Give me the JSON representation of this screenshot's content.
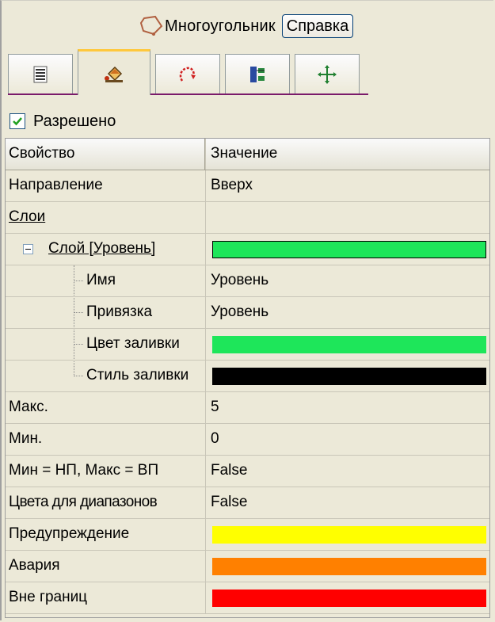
{
  "header": {
    "title": "Многоугольник",
    "help_label": "Справка",
    "icon": "polygon-icon"
  },
  "tabs": [
    {
      "icon": "list-icon",
      "active": false
    },
    {
      "icon": "paint-bucket-icon",
      "active": true
    },
    {
      "icon": "rotate-icon",
      "active": false
    },
    {
      "icon": "align-icon",
      "active": false
    },
    {
      "icon": "move-icon",
      "active": false
    }
  ],
  "enabled": {
    "label": "Разрешено",
    "checked": true
  },
  "grid": {
    "columns": [
      "Свойство",
      "Значение"
    ],
    "rows": {
      "direction": {
        "name": "Направление",
        "value": "Вверх"
      },
      "layers": {
        "name": "Слои",
        "value": ""
      },
      "layer": {
        "name": "Слой [Уровень]",
        "color": "#1ee65a"
      },
      "layer_name": {
        "name": "Имя",
        "value": "Уровень"
      },
      "layer_binding": {
        "name": "Привязка",
        "value": "Уровень"
      },
      "fill_color": {
        "name": "Цвет заливки",
        "color": "#1ee65a"
      },
      "fill_style": {
        "name": "Стиль заливки",
        "color": "#000000"
      },
      "max": {
        "name": "Макс.",
        "value": "5"
      },
      "min": {
        "name": "Мин.",
        "value": "0"
      },
      "min_max_np_vp": {
        "name": "Мин = НП, Макс = ВП",
        "value": "False"
      },
      "range_colors": {
        "name": "Цвета для диапазонов",
        "value": "False"
      },
      "warning": {
        "name": "Предупреждение",
        "color": "#ffff00"
      },
      "alarm": {
        "name": "Авария",
        "color": "#ff8000"
      },
      "out_of_bounds": {
        "name": "Вне границ",
        "color": "#ff0000"
      }
    }
  }
}
